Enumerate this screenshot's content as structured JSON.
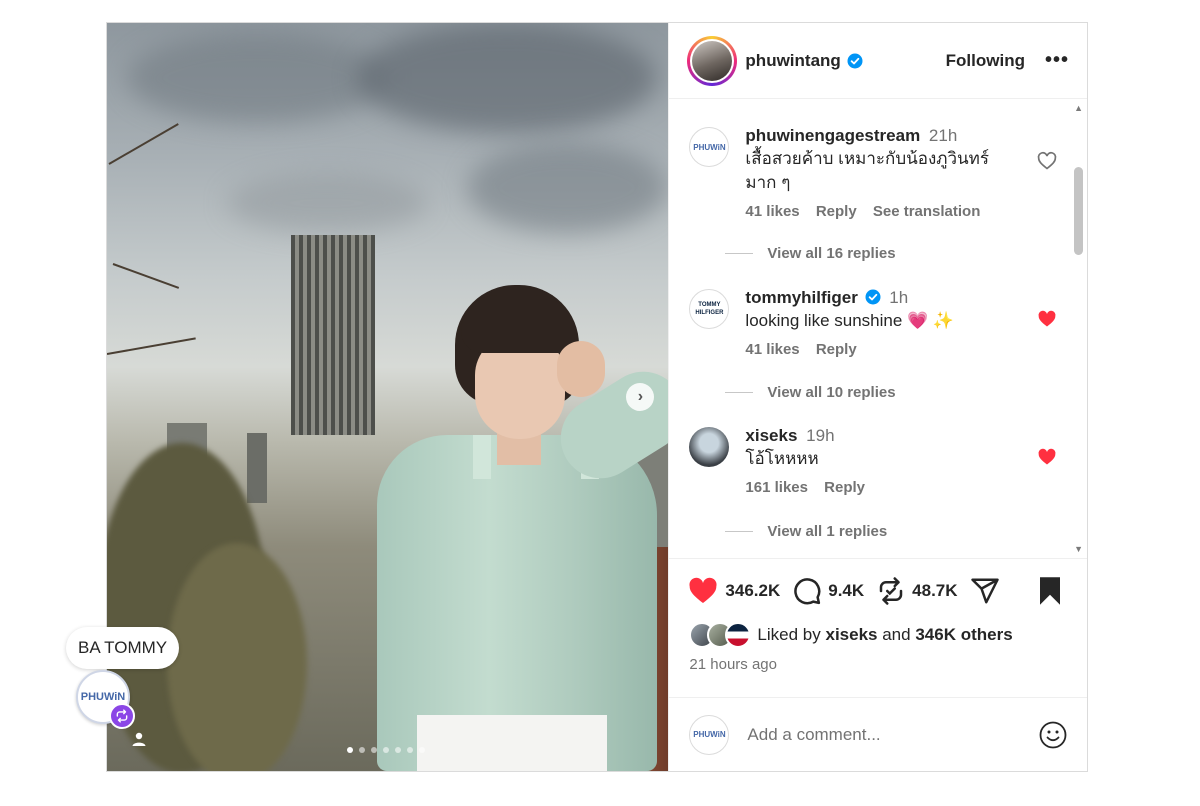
{
  "post": {
    "author": "phuwintang",
    "follow_state": "Following",
    "more_label": "•••",
    "photo": {
      "slides": 7,
      "active_slide": 0
    }
  },
  "bubble": {
    "label": "BA TOMMY",
    "avatar_text": "PHUWiN"
  },
  "comments": [
    {
      "user": "phuwinengagestream",
      "time": "21h",
      "text": "เสื้อสวยค้าบ เหมาะกับน้องภูวินทร์มาก ๆ",
      "likes": "41 likes",
      "reply": "Reply",
      "translate": "See translation",
      "liked": false,
      "replies": "View all 16 replies",
      "avatar_text": "PHUWiN"
    },
    {
      "user": "tommyhilfiger",
      "verified": true,
      "time": "1h",
      "text": "looking like sunshine 💗 ✨",
      "likes": "41 likes",
      "reply": "Reply",
      "liked": true,
      "replies": "View all 10 replies",
      "avatar_text": "TOMMY HILFIGER"
    },
    {
      "user": "xiseks",
      "time": "19h",
      "text": "โอ้โหหหห",
      "likes": "161 likes",
      "reply": "Reply",
      "liked": true,
      "replies": "View all 1 replies"
    }
  ],
  "actions": {
    "likes": "346.2K",
    "comments": "9.4K",
    "reposts": "48.7K"
  },
  "liked_by": {
    "prefix": "Liked by",
    "user": "xiseks",
    "and": "and",
    "others": "346K others"
  },
  "time_ago": "21 hours ago",
  "add_comment": {
    "placeholder": "Add a comment..."
  },
  "colors": {
    "heart_red": "#ff3040",
    "verified_blue": "#0095f6",
    "badge_purple": "#8b46e6"
  },
  "icons": [
    "chevron-right-icon",
    "verified-icon",
    "more-icon",
    "heart-icon",
    "comment-icon",
    "repost-icon",
    "share-icon",
    "bookmark-icon",
    "emoji-icon",
    "user-tag-icon",
    "repost-badge-icon"
  ]
}
